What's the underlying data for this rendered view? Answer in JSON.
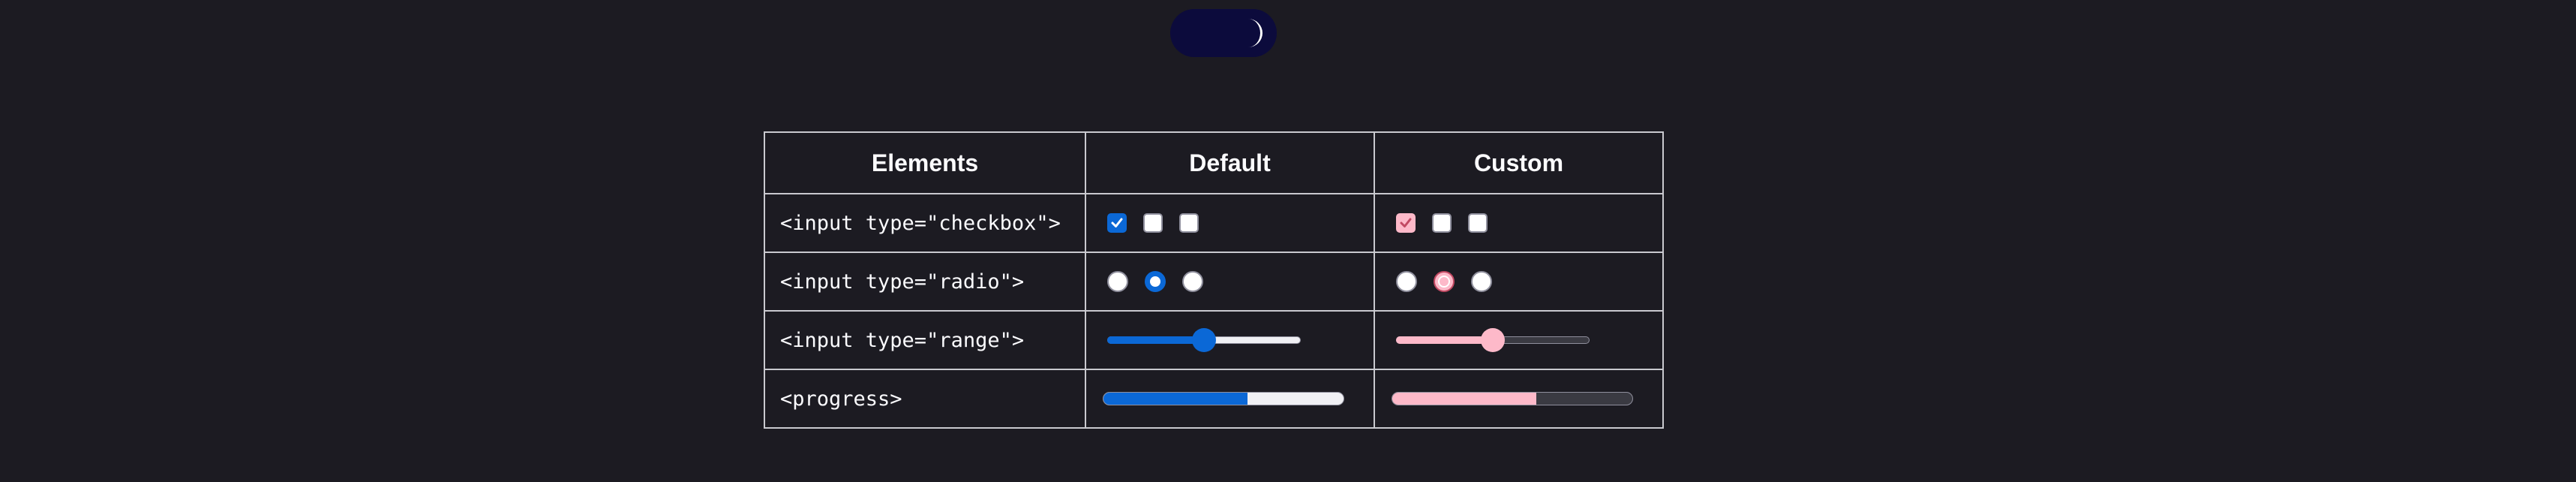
{
  "theme_toggle": {
    "icon": "moon-icon",
    "state": "dark"
  },
  "table": {
    "headers": [
      "Elements",
      "Default",
      "Custom"
    ],
    "rows": [
      {
        "element": "<input type=\"checkbox\">",
        "kind": "checkbox",
        "checked": [
          true,
          false,
          false
        ]
      },
      {
        "element": "<input type=\"radio\">",
        "kind": "radio",
        "selected_index": 1
      },
      {
        "element": "<input type=\"range\">",
        "kind": "range",
        "value": 0.5
      },
      {
        "element": "<progress>",
        "kind": "progress",
        "value": 0.6
      }
    ]
  },
  "colors": {
    "background": "#1c1b22",
    "default_accent": "#0b68d6",
    "custom_accent": "#fdb9c9",
    "toggle_bg": "#0c0b3c"
  }
}
